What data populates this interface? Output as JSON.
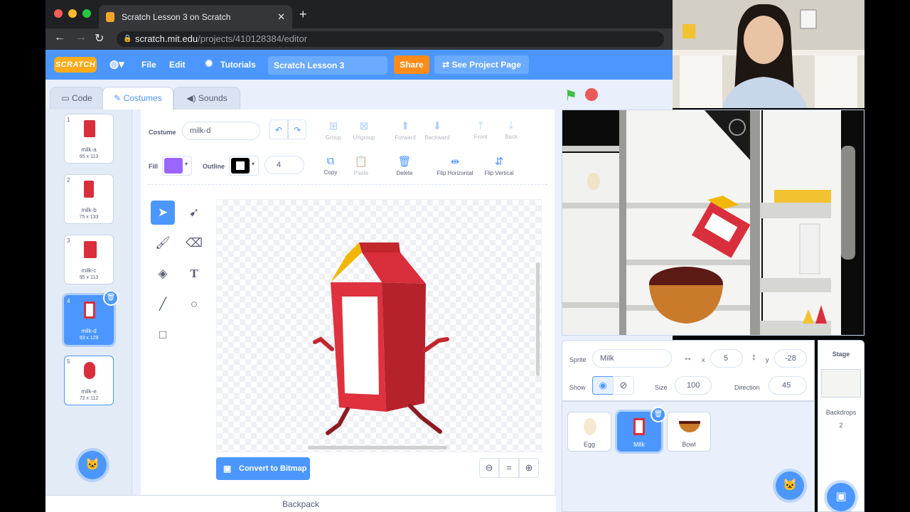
{
  "browser": {
    "tab_title": "Scratch Lesson 3 on Scratch",
    "url_host": "scratch.mit.edu",
    "url_path": "/projects/410128384/editor"
  },
  "menubar": {
    "logo": "SCRATCH",
    "file": "File",
    "edit": "Edit",
    "tutorials": "Tutorials",
    "project_title": "Scratch Lesson 3",
    "share": "Share",
    "see_project_page": "See Project Page"
  },
  "tabs": {
    "code": "Code",
    "costumes": "Costumes",
    "sounds": "Sounds"
  },
  "costumes": [
    {
      "num": "1",
      "name": "milk-a",
      "size": "65 x 113"
    },
    {
      "num": "2",
      "name": "milk-b",
      "size": "75 x 133"
    },
    {
      "num": "3",
      "name": "milk-c",
      "size": "95 x 113"
    },
    {
      "num": "4",
      "name": "milk-d",
      "size": "93 x 129"
    },
    {
      "num": "5",
      "name": "milk-e",
      "size": "72 x 112"
    }
  ],
  "paint": {
    "costume_label": "Costume",
    "costume_name": "milk-d",
    "fill_label": "Fill",
    "outline_label": "Outline",
    "outline_width": "4",
    "fill_color": "#9966ff",
    "tools": {
      "group": "Group",
      "ungroup": "Ungroup",
      "forward": "Forward",
      "backward": "Backward",
      "front": "Front",
      "back": "Back",
      "copy": "Copy",
      "paste": "Paste",
      "delete": "Delete",
      "flip_horizontal": "Flip Horizontal",
      "flip_vertical": "Flip Vertical"
    },
    "convert": "Convert to Bitmap",
    "zoom_reset": "="
  },
  "backpack": "Backpack",
  "sprite_info": {
    "sprite_label": "Sprite",
    "sprite_name": "Milk",
    "x_label": "x",
    "x": "5",
    "y_label": "y",
    "y": "-28",
    "show_label": "Show",
    "size_label": "Size",
    "size": "100",
    "direction_label": "Direction",
    "direction": "45"
  },
  "sprites": [
    {
      "name": "Egg"
    },
    {
      "name": "Milk"
    },
    {
      "name": "Bowl"
    }
  ],
  "stage_panel": {
    "title": "Stage",
    "backdrops_label": "Backdrops",
    "backdrops_count": "2"
  },
  "colors": {
    "accent": "#4c97ff",
    "share": "#ff8c1a",
    "milk_red": "#d92e3c"
  }
}
